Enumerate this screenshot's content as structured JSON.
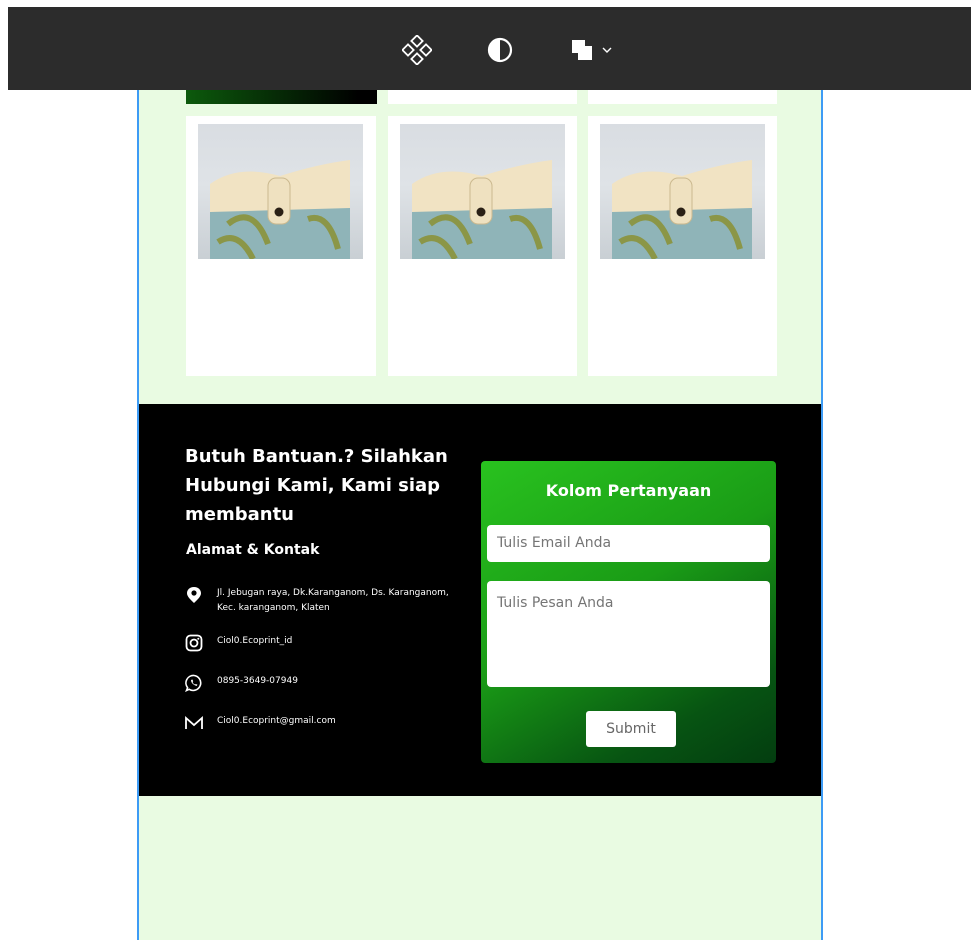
{
  "toolbar": {
    "tools": [
      {
        "icon": "components-icon"
      },
      {
        "icon": "contrast-icon"
      },
      {
        "icon": "boolean-union-icon"
      }
    ]
  },
  "products": {
    "count": 3,
    "image_alt": "tote bag"
  },
  "footer": {
    "help_title": "Butuh Bantuan.? Silahkan Hubungi Kami, Kami siap membantu",
    "address_title": "Alamat & Kontak",
    "contacts": [
      {
        "icon": "location-pin-icon",
        "text": "Jl. Jebugan raya, Dk.Karanganom, Ds. Karanganom, Kec. karanganom, Klaten"
      },
      {
        "icon": "instagram-icon",
        "text": "Ciol0.Ecoprint_id"
      },
      {
        "icon": "whatsapp-icon",
        "text": "0895-3649-07949"
      },
      {
        "icon": "mail-icon",
        "text": "Ciol0.Ecoprint@gmail.com"
      }
    ]
  },
  "form": {
    "title": "Kolom Pertanyaan",
    "email_placeholder": "Tulis Email Anda",
    "message_placeholder": "Tulis Pesan Anda",
    "submit_label": "Submit"
  },
  "colors": {
    "canvas_bg": "#e9fbe2",
    "footer_bg": "#000000",
    "accent_green": "#1a9c16",
    "frame_border": "#3d9bf5"
  }
}
